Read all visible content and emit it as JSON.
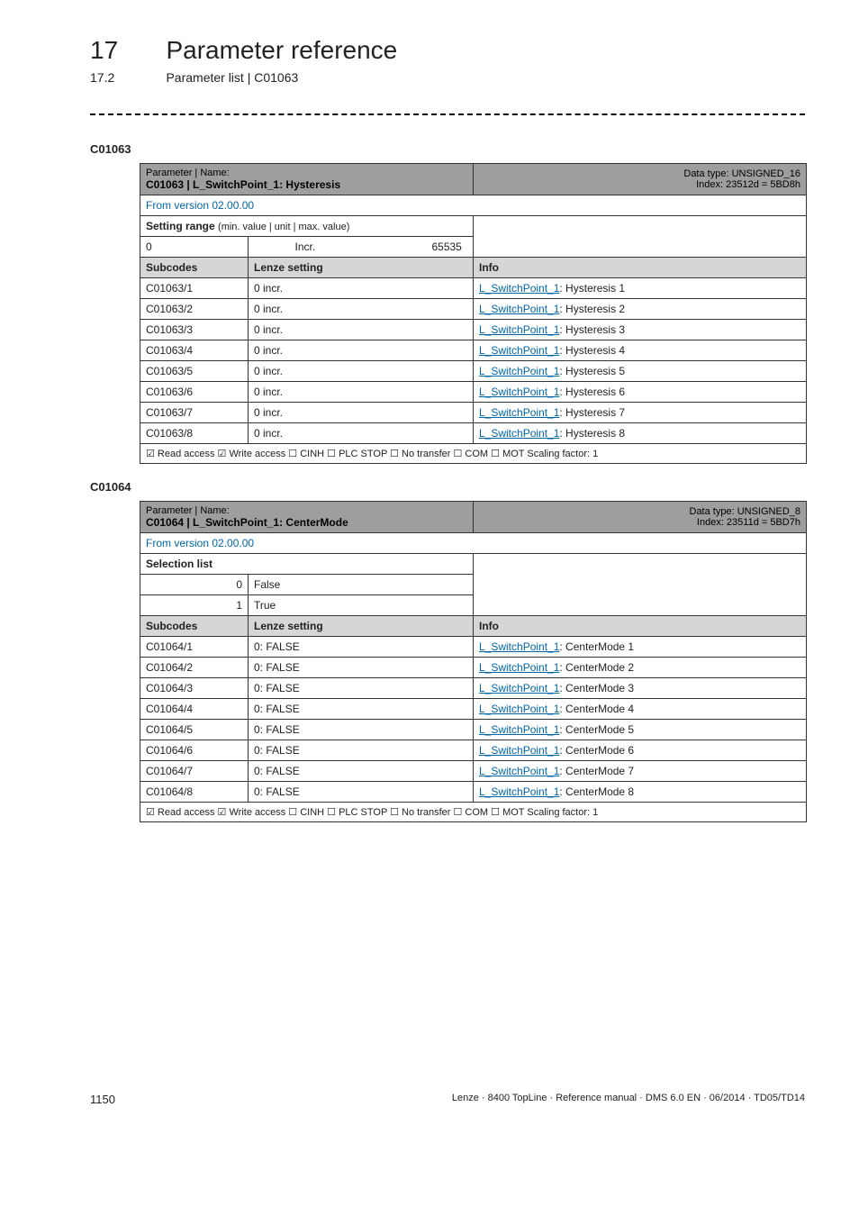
{
  "chapter": {
    "num": "17",
    "title": "Parameter reference"
  },
  "sub": {
    "num": "17.2",
    "title": "Parameter list | C01063"
  },
  "sections": [
    {
      "code": "C01063",
      "header": {
        "label": "Parameter | Name:",
        "name": "C01063 | L_SwitchPoint_1: Hysteresis",
        "datatype": "Data type: UNSIGNED_16",
        "index": "Index: 23512d = 5BD8h"
      },
      "version": "From version 02.00.00",
      "range": {
        "label": "Setting range",
        "suffix": "(min. value | unit | max. value)",
        "min": "0",
        "unit": "Incr.",
        "max": "65535"
      },
      "cols": {
        "a": "Subcodes",
        "b": "Lenze setting",
        "c": "Info"
      },
      "rows": [
        {
          "sc": "C01063/1",
          "set": "0 incr.",
          "link": "L_SwitchPoint_1",
          "tail": ": Hysteresis 1"
        },
        {
          "sc": "C01063/2",
          "set": "0 incr.",
          "link": "L_SwitchPoint_1",
          "tail": ": Hysteresis 2"
        },
        {
          "sc": "C01063/3",
          "set": "0 incr.",
          "link": "L_SwitchPoint_1",
          "tail": ": Hysteresis 3"
        },
        {
          "sc": "C01063/4",
          "set": "0 incr.",
          "link": "L_SwitchPoint_1",
          "tail": ": Hysteresis 4"
        },
        {
          "sc": "C01063/5",
          "set": "0 incr.",
          "link": "L_SwitchPoint_1",
          "tail": ": Hysteresis 5"
        },
        {
          "sc": "C01063/6",
          "set": "0 incr.",
          "link": "L_SwitchPoint_1",
          "tail": ": Hysteresis 6"
        },
        {
          "sc": "C01063/7",
          "set": "0 incr.",
          "link": "L_SwitchPoint_1",
          "tail": ": Hysteresis 7"
        },
        {
          "sc": "C01063/8",
          "set": "0 incr.",
          "link": "L_SwitchPoint_1",
          "tail": ": Hysteresis 8"
        }
      ],
      "access": "☑ Read access   ☑ Write access   ☐ CINH   ☐ PLC STOP   ☐ No transfer   ☐ COM   ☐ MOT     Scaling factor: 1"
    },
    {
      "code": "C01064",
      "header": {
        "label": "Parameter | Name:",
        "name": "C01064 | L_SwitchPoint_1: CenterMode",
        "datatype": "Data type: UNSIGNED_8",
        "index": "Index: 23511d = 5BD7h"
      },
      "version": "From version 02.00.00",
      "selection": {
        "label": "Selection list",
        "items": [
          {
            "n": "0",
            "v": "False"
          },
          {
            "n": "1",
            "v": "True"
          }
        ]
      },
      "cols": {
        "a": "Subcodes",
        "b": "Lenze setting",
        "c": "Info"
      },
      "rows": [
        {
          "sc": "C01064/1",
          "set": "0: FALSE",
          "link": "L_SwitchPoint_1",
          "tail": ": CenterMode 1"
        },
        {
          "sc": "C01064/2",
          "set": "0: FALSE",
          "link": "L_SwitchPoint_1",
          "tail": ": CenterMode 2"
        },
        {
          "sc": "C01064/3",
          "set": "0: FALSE",
          "link": "L_SwitchPoint_1",
          "tail": ": CenterMode 3"
        },
        {
          "sc": "C01064/4",
          "set": "0: FALSE",
          "link": "L_SwitchPoint_1",
          "tail": ": CenterMode 4"
        },
        {
          "sc": "C01064/5",
          "set": "0: FALSE",
          "link": "L_SwitchPoint_1",
          "tail": ": CenterMode 5"
        },
        {
          "sc": "C01064/6",
          "set": "0: FALSE",
          "link": "L_SwitchPoint_1",
          "tail": ": CenterMode 6"
        },
        {
          "sc": "C01064/7",
          "set": "0: FALSE",
          "link": "L_SwitchPoint_1",
          "tail": ": CenterMode 7"
        },
        {
          "sc": "C01064/8",
          "set": "0: FALSE",
          "link": "L_SwitchPoint_1",
          "tail": ": CenterMode 8"
        }
      ],
      "access": "☑ Read access   ☑ Write access   ☐ CINH   ☐ PLC STOP   ☐ No transfer   ☐ COM   ☐ MOT     Scaling factor: 1"
    }
  ],
  "footer": {
    "page": "1150",
    "right": "Lenze · 8400 TopLine · Reference manual · DMS 6.0 EN · 06/2014 · TD05/TD14"
  }
}
